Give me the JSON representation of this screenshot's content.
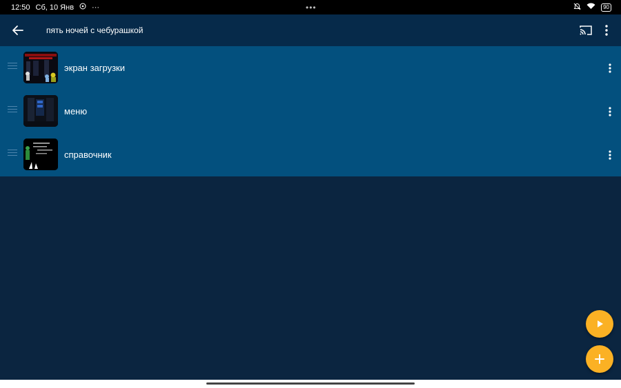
{
  "status_bar": {
    "time": "12:50",
    "date": "Сб, 10 Янв",
    "more": "···",
    "center_dots": "•••",
    "battery": "90"
  },
  "app_bar": {
    "title": "пять ночей с чебурашкой"
  },
  "scenes": [
    {
      "label": "экран загрузки"
    },
    {
      "label": "меню"
    },
    {
      "label": "справочник"
    }
  ],
  "colors": {
    "background": "#0b2540",
    "app_bar": "#062a4a",
    "list_background": "#03507e",
    "fab": "#fbb124"
  },
  "icons": {
    "back": "arrow-left-icon",
    "cast": "cast-icon",
    "overflow": "more-vertical-icon",
    "drag": "drag-handle-icon",
    "play": "play-icon",
    "add": "plus-icon"
  }
}
